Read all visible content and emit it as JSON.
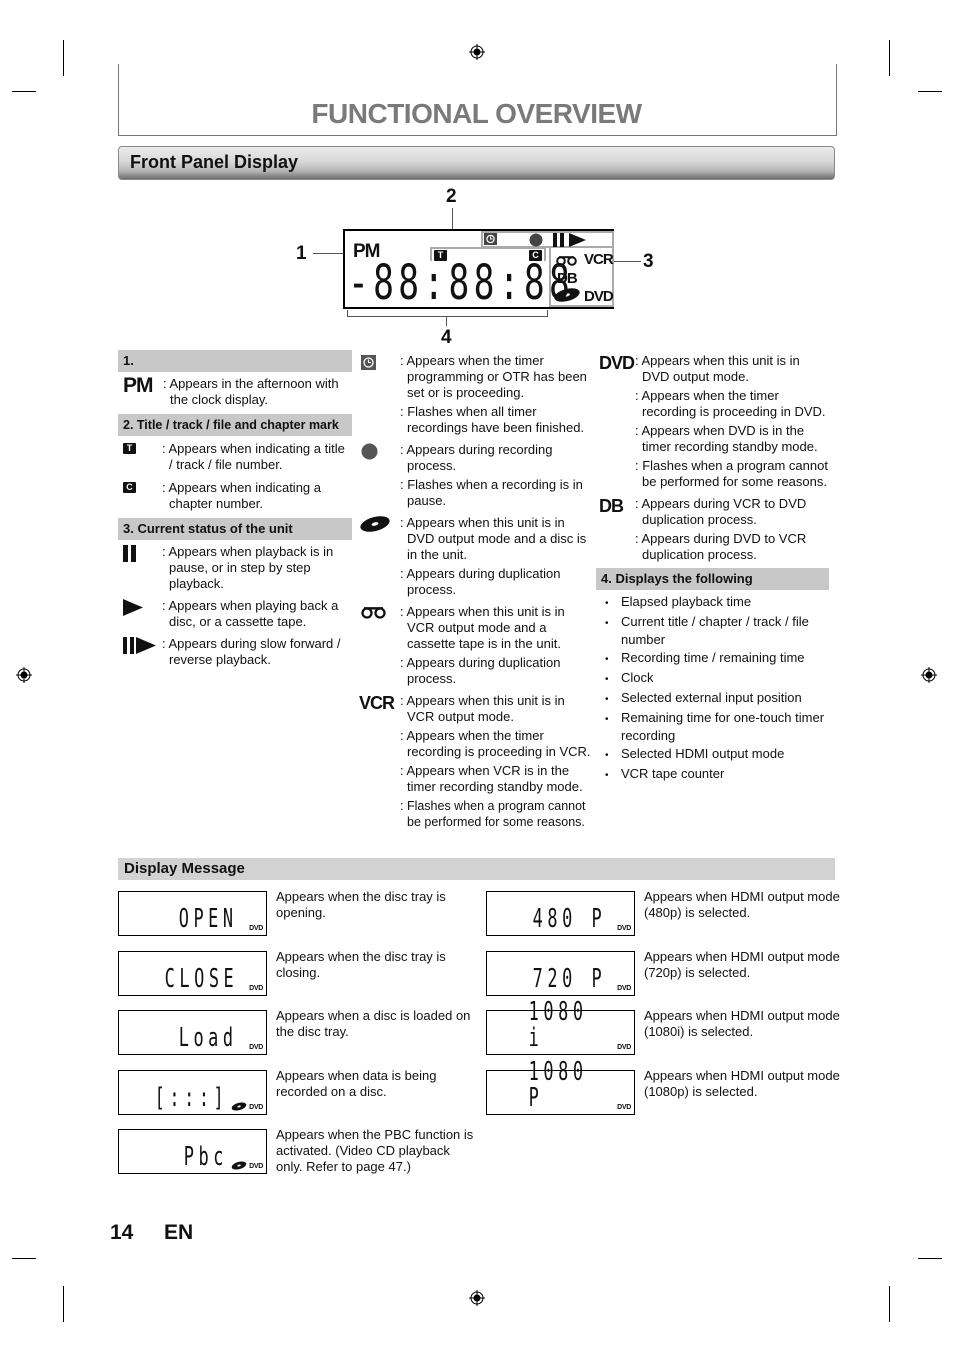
{
  "page": {
    "title": "FUNCTIONAL OVERVIEW",
    "section": "Front Panel Display",
    "page_number": "14",
    "language": "EN"
  },
  "diagram": {
    "callouts": [
      "1",
      "2",
      "3",
      "4"
    ],
    "pm": "PM",
    "title_mark": "T",
    "chapter_mark": "C",
    "digits": "-88:88:88",
    "vcr": "VCR",
    "db": "DB",
    "dvd": "DVD"
  },
  "col1": {
    "sec1": {
      "heading": "1.",
      "symbol": "PM",
      "desc": ": Appears in the afternoon with the clock display."
    },
    "sec2": {
      "heading": "2. Title / track / file and chapter mark",
      "items": [
        {
          "symbol": "T",
          "icon": "title-mark-icon",
          "desc": ": Appears when indicating a title / track / file number."
        },
        {
          "symbol": "C",
          "icon": "chapter-mark-icon",
          "desc": ": Appears when indicating a chapter number."
        }
      ]
    },
    "sec3": {
      "heading": "3. Current status of the unit",
      "items": [
        {
          "icon": "pause-icon",
          "desc": ": Appears when playback is in pause, or in step by step playback."
        },
        {
          "icon": "play-icon",
          "desc": ": Appears when playing back a disc, or a cassette tape."
        },
        {
          "icon": "slow-play-icon",
          "desc": ": Appears during slow forward / reverse playback."
        }
      ]
    }
  },
  "col2": {
    "timer": {
      "icon": "timer-icon",
      "descs": [
        ": Appears when the timer programming or OTR has been set or is proceeding.",
        ": Flashes when all timer recordings have been finished."
      ]
    },
    "record": {
      "icon": "record-icon",
      "descs": [
        ": Appears during recording process.",
        ": Flashes when a recording is in pause."
      ]
    },
    "disc": {
      "icon": "disc-icon",
      "descs": [
        ": Appears when this unit is in DVD output mode and a disc is in the unit.",
        ": Appears during duplication process."
      ]
    },
    "tape": {
      "icon": "cassette-icon",
      "descs": [
        ": Appears when this unit is in VCR output mode and a cassette tape is in the unit.",
        ": Appears during duplication process."
      ]
    },
    "vcr": {
      "symbol": "VCR",
      "descs": [
        ": Appears when this unit is in VCR output mode.",
        ": Appears when the timer recording is proceeding in VCR.",
        ": Appears when VCR is in the timer recording standby mode.",
        ": Flashes when a program cannot be performed for some reasons."
      ]
    }
  },
  "col3": {
    "dvd": {
      "symbol": "DVD",
      "descs": [
        ": Appears when this unit is in DVD output mode.",
        ": Appears when the timer recording is proceeding in DVD.",
        ": Appears when DVD is in the timer recording standby mode.",
        ": Flashes when a program cannot be performed for some reasons."
      ]
    },
    "db": {
      "symbol": "DB",
      "descs": [
        ": Appears during VCR to DVD duplication process.",
        ": Appears during DVD to VCR duplication process."
      ]
    },
    "sec4": {
      "heading": "4. Displays the following",
      "items": [
        "Elapsed playback time",
        "Current title / chapter / track / file number",
        "Recording time / remaining time",
        "Clock",
        "Selected external input position",
        "Remaining time for one-touch timer recording",
        "Selected HDMI output mode",
        "VCR tape counter"
      ]
    }
  },
  "display_message": {
    "heading": "Display Message",
    "dvd_label": "DVD",
    "left": [
      {
        "lcd": "OPEN",
        "disc": false,
        "text": "Appears when the disc tray is opening."
      },
      {
        "lcd": "CLOSE",
        "disc": false,
        "text": "Appears when the disc tray is closing."
      },
      {
        "lcd": "Load",
        "disc": false,
        "text": "Appears when a disc is loaded on the disc tray."
      },
      {
        "lcd": "[:::]",
        "disc": true,
        "text": "Appears when data is being recorded on a disc."
      },
      {
        "lcd": "Pbc",
        "disc": true,
        "text": "Appears when the PBC function is activated. (Video CD playback only. Refer to page 47.)"
      }
    ],
    "right": [
      {
        "lcd": "480 P",
        "disc": false,
        "text": "Appears when HDMI output mode (480p) is selected."
      },
      {
        "lcd": "720 P",
        "disc": false,
        "text": "Appears when HDMI output mode (720p) is selected."
      },
      {
        "lcd": "1080 i",
        "disc": false,
        "text": "Appears when HDMI output mode (1080i) is selected."
      },
      {
        "lcd": "1080 P",
        "disc": false,
        "text": "Appears when HDMI output mode (1080p) is selected."
      }
    ]
  }
}
